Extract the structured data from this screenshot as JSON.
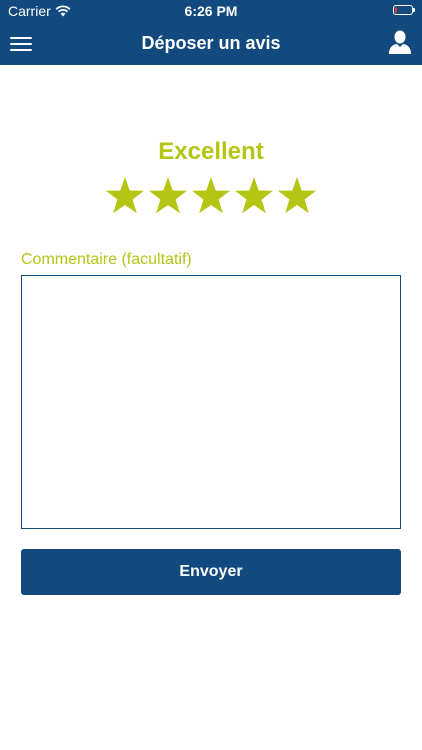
{
  "status_bar": {
    "carrier": "Carrier",
    "time": "6:26 PM",
    "battery_level": 0.1,
    "battery_color": "#e8362c"
  },
  "navbar": {
    "title": "Déposer un avis",
    "menu_icon": "hamburger-menu-icon",
    "profile_icon": "user-profile-icon"
  },
  "rating": {
    "label": "Excellent",
    "value": 5,
    "max": 5,
    "color": "#b5c513"
  },
  "comment": {
    "label": "Commentaire (facultatif)",
    "value": "",
    "placeholder": ""
  },
  "submit": {
    "label": "Envoyer"
  },
  "colors": {
    "primary": "#124a7f",
    "accent": "#b5c513"
  }
}
